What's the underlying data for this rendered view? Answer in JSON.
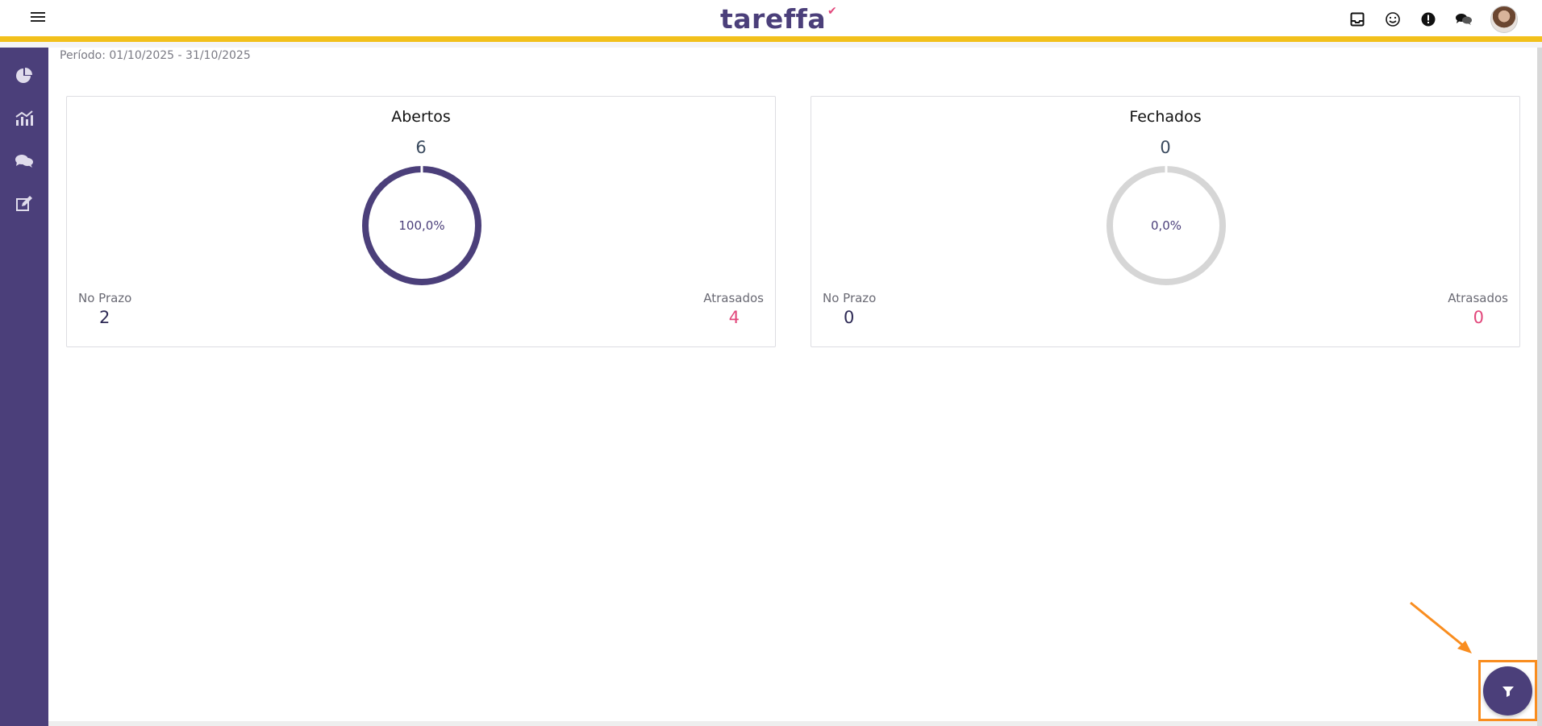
{
  "header": {
    "logo_text": "tareffa",
    "icons": [
      "inbox-icon",
      "smile-icon",
      "alert-icon",
      "chat-icon"
    ],
    "avatar": "user-avatar"
  },
  "sidebar": {
    "items": [
      {
        "icon": "pie-chart-icon"
      },
      {
        "icon": "bar-chart-icon"
      },
      {
        "icon": "chat-bubbles-icon"
      },
      {
        "icon": "edit-icon"
      }
    ]
  },
  "period": "Período: 01/10/2025 - 31/10/2025",
  "cards": [
    {
      "title": "Abertos",
      "total": "6",
      "percent_label": "100,0%",
      "percent_value": 100,
      "on_time_label": "No Prazo",
      "on_time_value": "2",
      "late_label": "Atrasados",
      "late_value": "4",
      "ring_color": "#4b3f7a"
    },
    {
      "title": "Fechados",
      "total": "0",
      "percent_label": "0,0%",
      "percent_value": 0,
      "on_time_label": "No Prazo",
      "on_time_value": "0",
      "late_label": "Atrasados",
      "late_value": "0",
      "ring_color": "#d6d6d6"
    }
  ],
  "fab": {
    "icon": "filter-icon"
  },
  "colors": {
    "brand": "#4b3f7a",
    "accent_bar": "#f2c01b",
    "late": "#e2477b",
    "highlight": "#f98d1f"
  }
}
